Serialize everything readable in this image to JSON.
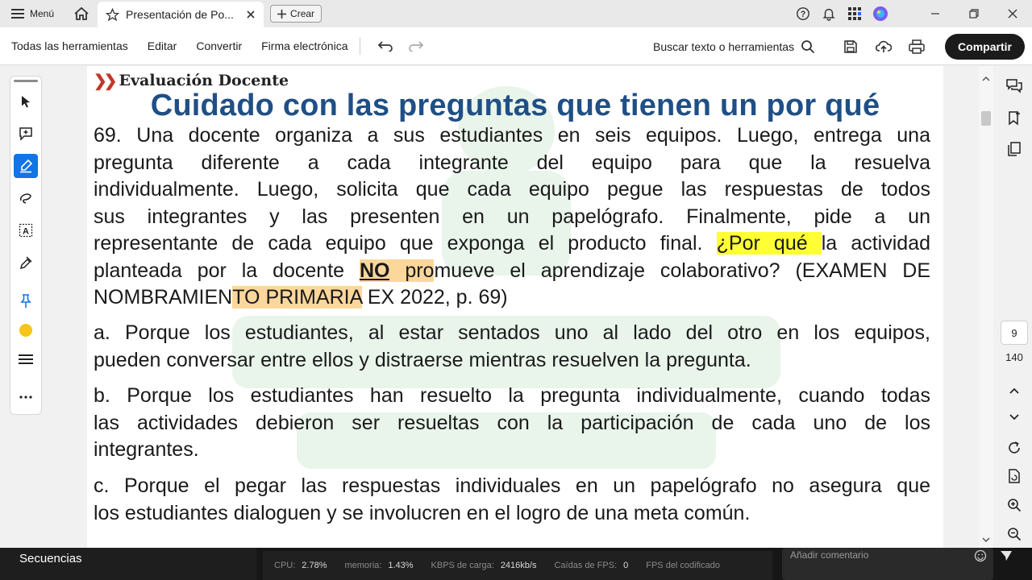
{
  "tabbar": {
    "menu_label": "Menú",
    "tab_title": "Presentación de Po...",
    "new_tab_label": "Crear"
  },
  "toolbar": {
    "menus": [
      "Todas las herramientas",
      "Editar",
      "Convertir",
      "Firma electrónica"
    ],
    "search_label": "Buscar texto o herramientas",
    "share_label": "Compartir"
  },
  "document": {
    "brand": "Evaluación Docente",
    "title": "Cuidado con las preguntas que tienen un por qué",
    "question_lines": [
      "69. Una docente organiza a sus estudiantes en seis equipos. Luego, entrega una",
      "pregunta diferente a cada integrante del equipo para que la resuelva",
      "individualmente. Luego, solicita que cada equipo pegue las respuestas de todos",
      "sus integrantes y las presenten en un papelógrafo. Finalmente, pide a un"
    ],
    "q_line5_a": "representante de cada equipo que exponga el producto final. ",
    "q_line5_hl": "¿Por qué ",
    "q_line5_b": "la actividad",
    "q_line6_a": "planteada por la docente ",
    "q_line6_no": "NO",
    "q_line6_pro": " pro",
    "q_line6_b": "mueve el aprendizaje colaborativo? (EXAMEN DE",
    "q_line7_a": "NOMBRAMIEN",
    "q_line7_hl": "TO PRIMARIA",
    "q_line7_b": " EX 2022, p. 69)",
    "option_a": [
      "a. Porque los estudiantes, al estar sentados uno al lado del otro en los equipos,",
      "pueden conversar entre ellos y distraerse mientras resuelven la pregunta."
    ],
    "option_b": [
      "b. Porque los estudiantes han resuelto la pregunta individualmente, cuando todas",
      "las actividades debieron ser resueltas con la participación de cada uno de los",
      "integrantes."
    ],
    "option_c": [
      "c. Porque el pegar las respuestas individuales en un papelógrafo no asegura que",
      "los estudiantes dialoguen y se involucren en el logro de una meta común."
    ]
  },
  "navigation": {
    "current_page": "9",
    "total_pages": "140"
  },
  "stream": {
    "scene_label": "Secuencias",
    "stats": [
      {
        "label": "CPU:",
        "value": "2.78%"
      },
      {
        "label": "memoria:",
        "value": "1.43%"
      },
      {
        "label": "KBPS de carga:",
        "value": "2416kb/s"
      },
      {
        "label": "Caídas de FPS:",
        "value": "0"
      },
      {
        "label": "FPS del codificado",
        "value": ""
      }
    ],
    "comment_placeholder": "Añadir comentario"
  },
  "colors": {
    "title_blue": "#1f4f85",
    "highlight_yellow": "#ffff33",
    "highlight_orange": "#fbd79b",
    "accent_blue": "#1473e6"
  }
}
